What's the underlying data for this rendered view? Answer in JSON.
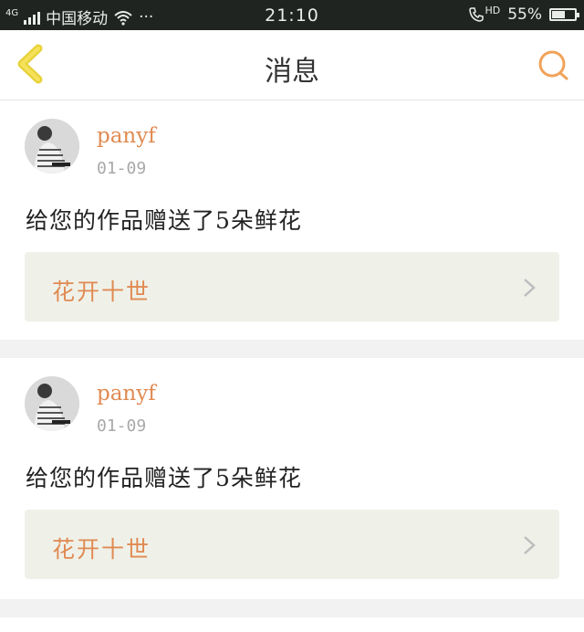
{
  "status_bar": {
    "network": "4G",
    "carrier": "中国移动",
    "more": "···",
    "time": "21:10",
    "hd": "HD",
    "battery": "55%",
    "battery_level": 0.55,
    "icons": [
      "signal-icon",
      "wifi-icon",
      "phone-hd-icon",
      "battery-icon"
    ]
  },
  "header": {
    "title": "消息",
    "back_icon": "chevron-left-icon",
    "search_icon": "search-icon",
    "accent_color": "#f0a35a"
  },
  "messages": [
    {
      "username": "panyf",
      "date": "01-09",
      "text": "给您的作品赠送了5朵鲜花",
      "work_title": "花开十世"
    },
    {
      "username": "panyf",
      "date": "01-09",
      "text": "给您的作品赠送了5朵鲜花",
      "work_title": "花开十世"
    }
  ]
}
